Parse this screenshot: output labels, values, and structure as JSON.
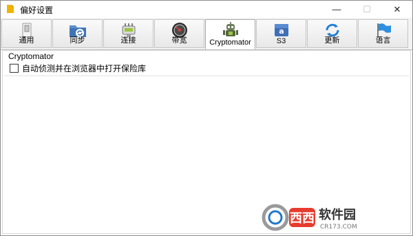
{
  "window": {
    "title": "偏好设置"
  },
  "window_controls": {
    "minimize": "—",
    "maximize": "☐",
    "close": "✕"
  },
  "tabs": [
    {
      "label": "通用",
      "icon": "switch-icon"
    },
    {
      "label": "同步",
      "icon": "sync-folder-icon"
    },
    {
      "label": "连接",
      "icon": "network-connector-icon"
    },
    {
      "label": "带宽",
      "icon": "speedometer-icon"
    },
    {
      "label": "Cryptomator",
      "icon": "cryptomator-robot-icon",
      "active": true
    },
    {
      "label": "S3",
      "icon": "amazon-s3-icon"
    },
    {
      "label": "更新",
      "icon": "refresh-icon"
    },
    {
      "label": "语言",
      "icon": "flag-icon"
    }
  ],
  "panel": {
    "group_title": "Cryptomator",
    "checkbox_label": "自动侦测并在浏览器中打开保险库",
    "checkbox_checked": false
  },
  "watermark": {
    "brand": "西西软件园",
    "domain": "CR173.COM"
  }
}
